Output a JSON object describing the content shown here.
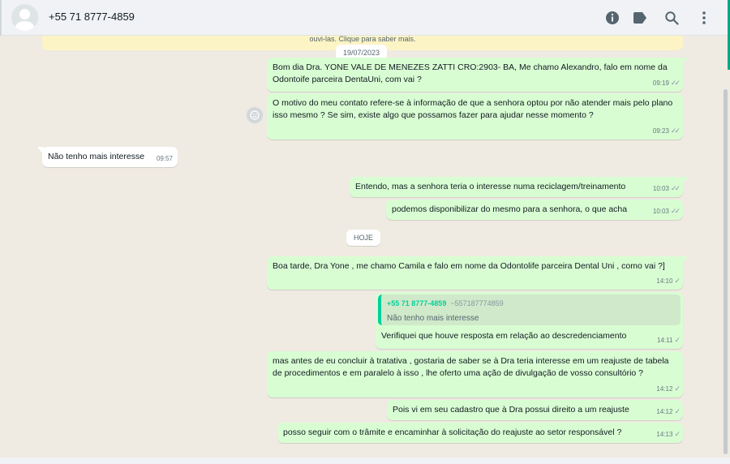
{
  "header": {
    "contact_name": "+55 71 8777-4859",
    "icons": [
      "info-icon",
      "label-icon",
      "search-icon",
      "menu-icon"
    ]
  },
  "notice": {
    "text": "ouvi-las. Clique para saber mais."
  },
  "dates": [
    "19/07/2023",
    "HOJE"
  ],
  "messages": [
    {
      "text": "Bom dia Dra. YONE VALE DE MENEZES ZATTI CRO:2903- BA, Me chamo Alexandro, falo em nome da Odontoife parceira DentaUni, com vai ?",
      "time": "09:19",
      "status": "read"
    },
    {
      "text": "O motivo do meu contato refere-se à informação de que a senhora optou por não atender mais pelo plano isso mesmo ? Se sim, existe algo que possamos fazer para ajudar nesse momento ?",
      "time": "09:23",
      "status": "read"
    },
    {
      "text": "Não tenho mais interesse",
      "time": "09:57",
      "direction": "in"
    },
    {
      "text": "Entendo, mas a senhora teria o interesse numa reciclagem/treinamento",
      "time": "10:03",
      "status": "read"
    },
    {
      "text": "podemos disponibilizar do mesmo para a senhora, o que acha",
      "time": "10:03",
      "status": "read"
    },
    {
      "text": "Boa tarde, Dra Yone , me chamo Camila e falo em nome da Odontolife parceira Dental Uni , como vai ?]",
      "time": "14:10",
      "status": "sent"
    },
    {
      "text": "Verifiquei que houve resposta em relação ao descredenciamento",
      "time": "14:11",
      "status": "sent",
      "quote": {
        "author": "+55 71 8777-4859",
        "sub": "~557187774859",
        "text": "Não tenho mais interesse"
      }
    },
    {
      "text": "mas antes de eu concluir à tratativa , gostaria de saber se à Dra teria interesse em um reajuste de tabela de procedimentos e em paralelo à isso , lhe oferto uma ação de divulgação de vosso consultório ?",
      "time": "14:12",
      "status": "sent"
    },
    {
      "text": "Pois vi em seu cadastro que à Dra possui direito a um reajuste",
      "time": "14:12",
      "status": "sent"
    },
    {
      "text": "posso seguir com o trâmite e encaminhar à solicitação do reajuste ao setor responsável ?",
      "time": "14:13",
      "status": "sent"
    }
  ],
  "colors": {
    "accent": "#00a884",
    "outgoing": "#d9fdd3",
    "background": "#efeae2"
  }
}
